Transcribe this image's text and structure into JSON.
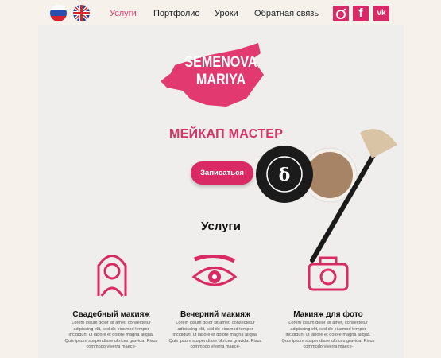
{
  "header": {
    "languages": [
      {
        "name": "ru-flag-icon"
      },
      {
        "name": "uk-flag-icon"
      }
    ],
    "nav": [
      {
        "label": "Услуги",
        "active": true
      },
      {
        "label": "Портфолио"
      },
      {
        "label": "Уроки"
      },
      {
        "label": "Обратная связь"
      }
    ],
    "social": [
      {
        "icon": "instagram-icon"
      },
      {
        "icon": "facebook-icon",
        "glyph": "f"
      },
      {
        "icon": "vk-icon",
        "glyph": "vk"
      }
    ]
  },
  "hero": {
    "logo_line1": "SEMENOVA",
    "logo_line2": "MARIYA",
    "title": "МЕЙКАП МАСТЕР",
    "cta": "Записаться"
  },
  "services": {
    "heading": "Услуги",
    "items": [
      {
        "icon": "bride-icon",
        "title": "Свадебный макияж",
        "text": "Lorem ipsum dolor sit amet, consectetur adipiscing elit, sed do eiusmod tempor incididunt ut labore et dolore magna aliqua. Quis ipsum suspendisse ultrices gravida. Risus commodo viverra maece-"
      },
      {
        "icon": "eye-icon",
        "title": "Вечерний макияж",
        "text": "Lorem ipsum dolor sit amet, consectetur adipiscing elit, sed do eiusmod tempor incididunt ut labore et dolore magna aliqua. Quis ipsum suspendisse ultrices gravida. Risus commodo viverra maece-"
      },
      {
        "icon": "camera-icon",
        "title": "Макияж для фото",
        "text": "Lorem ipsum dolor sit amet, consectetur adipiscing elit, sed do eiusmod tempor incididunt ut labore et dolore magna aliqua. Quis ipsum suspendisse ultrices gravida. Risus commodo viverra maece-"
      }
    ]
  },
  "colors": {
    "accent": "#d92a66",
    "background": "#f6f1eb",
    "panel": "#efeeec"
  }
}
